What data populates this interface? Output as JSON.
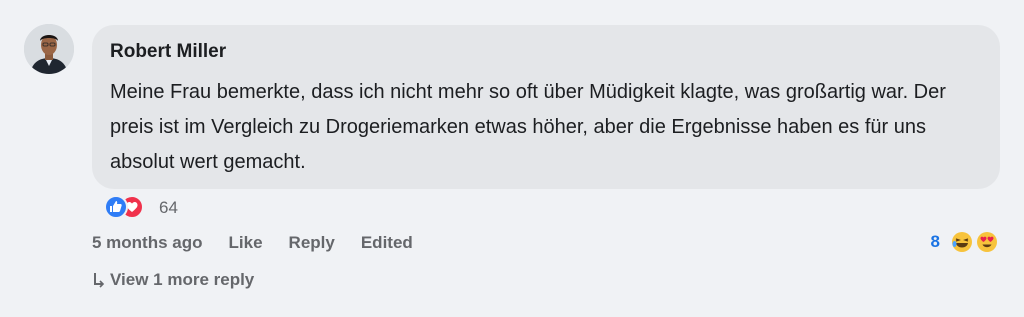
{
  "comment": {
    "author": "Robert Miller",
    "text": "Meine Frau bemerkte, dass ich nicht mehr so oft über Müdigkeit klagte, was großartig war. Der preis ist im Vergleich zu Drogeriemarken etwas höher, aber die Ergebnisse haben es für uns absolut wert gemacht.",
    "reactions": {
      "icons": [
        "like-icon",
        "love-icon"
      ],
      "count": "64"
    },
    "actions": {
      "time": "5 months ago",
      "like": "Like",
      "reply": "Reply",
      "edited": "Edited"
    },
    "reply_reactions": {
      "count": "8",
      "icons": [
        "laughing-emoji-icon",
        "heart-eyes-emoji-icon"
      ]
    },
    "view_replies": "View 1 more reply"
  },
  "colors": {
    "background": "#f0f2f5",
    "bubble": "#e4e6e9",
    "secondary_text": "#65676b",
    "accent": "#1b74e4",
    "like": "#2f7df6",
    "love": "#f0324c"
  }
}
